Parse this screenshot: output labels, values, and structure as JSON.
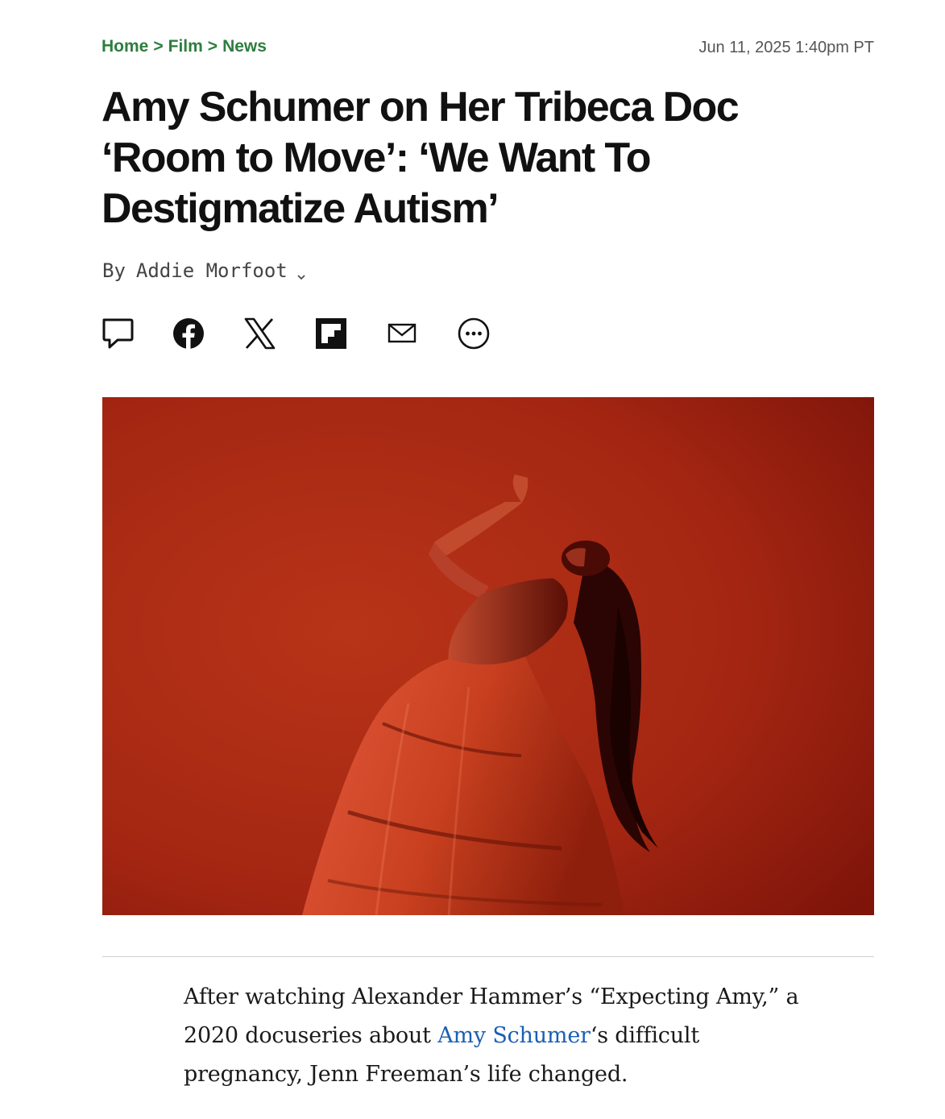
{
  "breadcrumb": {
    "home": "Home",
    "film": "Film",
    "news": "News",
    "separator": ">"
  },
  "timestamp": "Jun 11, 2025 1:40pm PT",
  "headline": {
    "line1": "Amy Schumer on Her Tribeca Doc",
    "line2": "‘Room to Move’: ‘We Want To",
    "line3": "Destigmatize Autism’"
  },
  "byline": {
    "prefix": "By",
    "author": "Addie Morfoot"
  },
  "share_icons": [
    "comment-icon",
    "facebook-icon",
    "x-icon",
    "flipboard-icon",
    "email-icon",
    "more-icon"
  ],
  "article": {
    "line1": "After watching Alexander Hammer’s “Expecting Amy,” a",
    "line2_before": "2020 docuseries about ",
    "line2_link": "Amy Schumer",
    "line2_after": "‘s difficult",
    "line3": "pregnancy, Jenn Freeman’s life changed."
  },
  "colors": {
    "breadcrumb": "#2e7d3e",
    "link": "#1a5fb4",
    "hero_background": "#a82a14"
  }
}
